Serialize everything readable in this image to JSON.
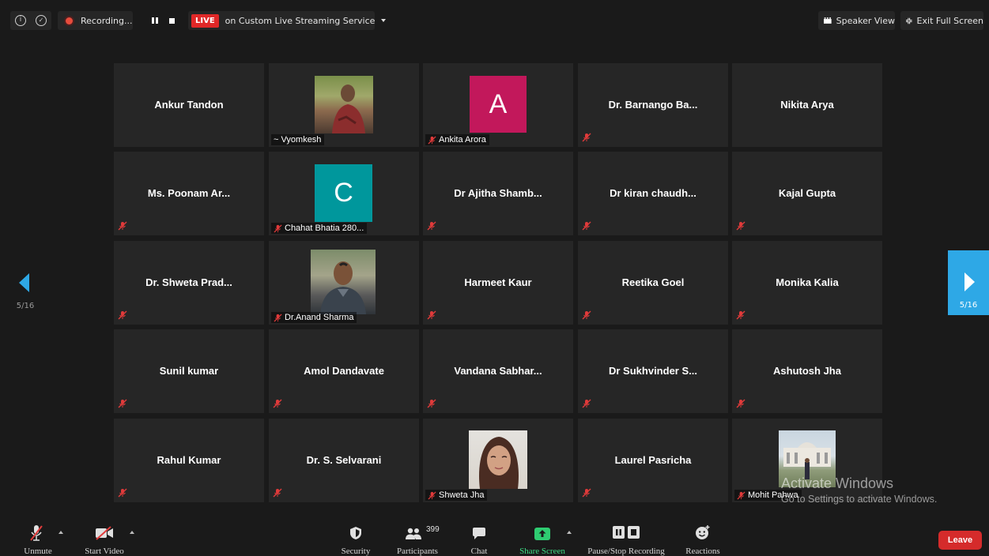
{
  "topbar": {
    "recording_label": "Recording...",
    "live_label": "LIVE",
    "stream_label": "on Custom Live Streaming Service",
    "speaker_view_label": "Speaker View",
    "exit_fullscreen_label": "Exit Full Screen"
  },
  "grid": {
    "tiles": [
      {
        "name": "Ankur Tandon"
      },
      {
        "name": "~ Vyomkesh"
      },
      {
        "name": "Ankita Arora",
        "initial": "A"
      },
      {
        "name": "Dr. Barnango Ba..."
      },
      {
        "name": "Nikita Arya"
      },
      {
        "name": "Ms. Poonam Ar..."
      },
      {
        "name": "Chahat Bhatia 280...",
        "initial": "C"
      },
      {
        "name": "Dr Ajitha Shamb..."
      },
      {
        "name": "Dr kiran chaudh..."
      },
      {
        "name": "Kajal Gupta"
      },
      {
        "name": "Dr. Shweta Prad..."
      },
      {
        "name": "Dr.Anand Sharma"
      },
      {
        "name": "Harmeet Kaur"
      },
      {
        "name": "Reetika Goel"
      },
      {
        "name": "Monika Kalia"
      },
      {
        "name": "Sunil kumar"
      },
      {
        "name": "Amol Dandavate"
      },
      {
        "name": "Vandana Sabhar..."
      },
      {
        "name": "Dr Sukhvinder S..."
      },
      {
        "name": "Ashutosh Jha"
      },
      {
        "name": "Rahul Kumar"
      },
      {
        "name": "Dr. S. Selvarani"
      },
      {
        "name": "Shweta Jha"
      },
      {
        "name": "Laurel Pasricha"
      },
      {
        "name": "Mohit Pahwa"
      }
    ],
    "avatar_colors": {
      "ankita": "#c2185b",
      "chahat": "#00979c"
    }
  },
  "pagination": {
    "left": "5/16",
    "right": "5/16"
  },
  "toolbar": {
    "unmute": "Unmute",
    "start_video": "Start Video",
    "security": "Security",
    "participants": "Participants",
    "participants_count": "399",
    "chat": "Chat",
    "share_screen": "Share Screen",
    "pause_recording": "Pause/Stop Recording",
    "reactions": "Reactions",
    "leave": "Leave"
  },
  "watermark": {
    "line1": "Activate Windows",
    "line2": "Go to Settings to activate Windows."
  }
}
